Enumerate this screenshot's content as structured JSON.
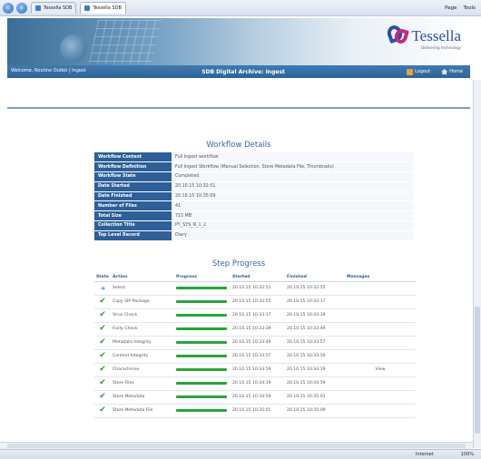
{
  "browser": {
    "tabs": [
      {
        "label": "Tessella SDB"
      },
      {
        "label": "Tessella SDB"
      }
    ],
    "commands": [
      "Page",
      "Tools"
    ]
  },
  "header": {
    "brand": "Tessella",
    "brand_sub": "Delivering technology"
  },
  "navbar": {
    "welcome": "Welcome, Routine Outlet",
    "breadcrumb": "Ingest",
    "title": "SDB Digital Archive: Ingest",
    "logout_label": "Logout",
    "home_label": "Home"
  },
  "workflow": {
    "title": "Workflow Details",
    "rows": [
      {
        "label": "Workflow Context",
        "value": "Full Ingest workflow"
      },
      {
        "label": "Workflow Definition",
        "value": "Full Ingest Workflow (Manual Selection, Store Metadata File, Thumbnails)"
      },
      {
        "label": "Workflow State",
        "value": "Completed"
      },
      {
        "label": "Date Started",
        "value": "20.10.15 10:32:51"
      },
      {
        "label": "Date Finished",
        "value": "20.10.15 10:35:09"
      },
      {
        "label": "Number of Files",
        "value": "41"
      },
      {
        "label": "Total Size",
        "value": "715 MB"
      },
      {
        "label": "Collection Title",
        "value": "PY_SYS_N_1_2"
      },
      {
        "label": "Top Level Record",
        "value": "Diary"
      }
    ]
  },
  "steps": {
    "title": "Step Progress",
    "columns": [
      "State",
      "Action",
      "Progress",
      "Started",
      "Finished",
      "Messages"
    ],
    "rows": [
      {
        "state": "running",
        "action": "Select",
        "progress": 1.0,
        "started": "20.10.15 10:32:51",
        "finished": "20.10.15 10:32:55",
        "message": ""
      },
      {
        "state": "done",
        "action": "Copy SIP Package",
        "progress": 1.0,
        "started": "20.10.15 10:32:55",
        "finished": "20.10.15 10:33:17",
        "message": ""
      },
      {
        "state": "done",
        "action": "Virus Check",
        "progress": 1.0,
        "started": "20.10.15 10:33:17",
        "finished": "20.10.15 10:33:39",
        "message": ""
      },
      {
        "state": "done",
        "action": "Fixity Check",
        "progress": 1.0,
        "started": "20.10.15 10:33:39",
        "finished": "20.10.15 10:33:49",
        "message": ""
      },
      {
        "state": "done",
        "action": "Metadata Integrity",
        "progress": 1.0,
        "started": "20.10.15 10:33:49",
        "finished": "20.10.15 10:33:57",
        "message": ""
      },
      {
        "state": "done",
        "action": "Content Integrity",
        "progress": 1.0,
        "started": "20.10.15 10:33:57",
        "finished": "20.10.15 10:33:59",
        "message": ""
      },
      {
        "state": "done",
        "action": "Characterise",
        "progress": 1.0,
        "started": "20.10.15 10:33:59",
        "finished": "20.10.15 10:34:19",
        "message": "View"
      },
      {
        "state": "done",
        "action": "Store Files",
        "progress": 1.0,
        "started": "20.10.15 10:34:19",
        "finished": "20.10.15 10:34:59",
        "message": ""
      },
      {
        "state": "done",
        "action": "Store Metadata",
        "progress": 1.0,
        "started": "20.10.15 10:34:59",
        "finished": "20.10.15 10:35:01",
        "message": ""
      },
      {
        "state": "done",
        "action": "Store Metadata File",
        "progress": 1.0,
        "started": "20.10.15 10:35:01",
        "finished": "20.10.15 10:35:09",
        "message": ""
      }
    ]
  },
  "statusbar": {
    "zone": "Internet",
    "zoom": "100%"
  }
}
